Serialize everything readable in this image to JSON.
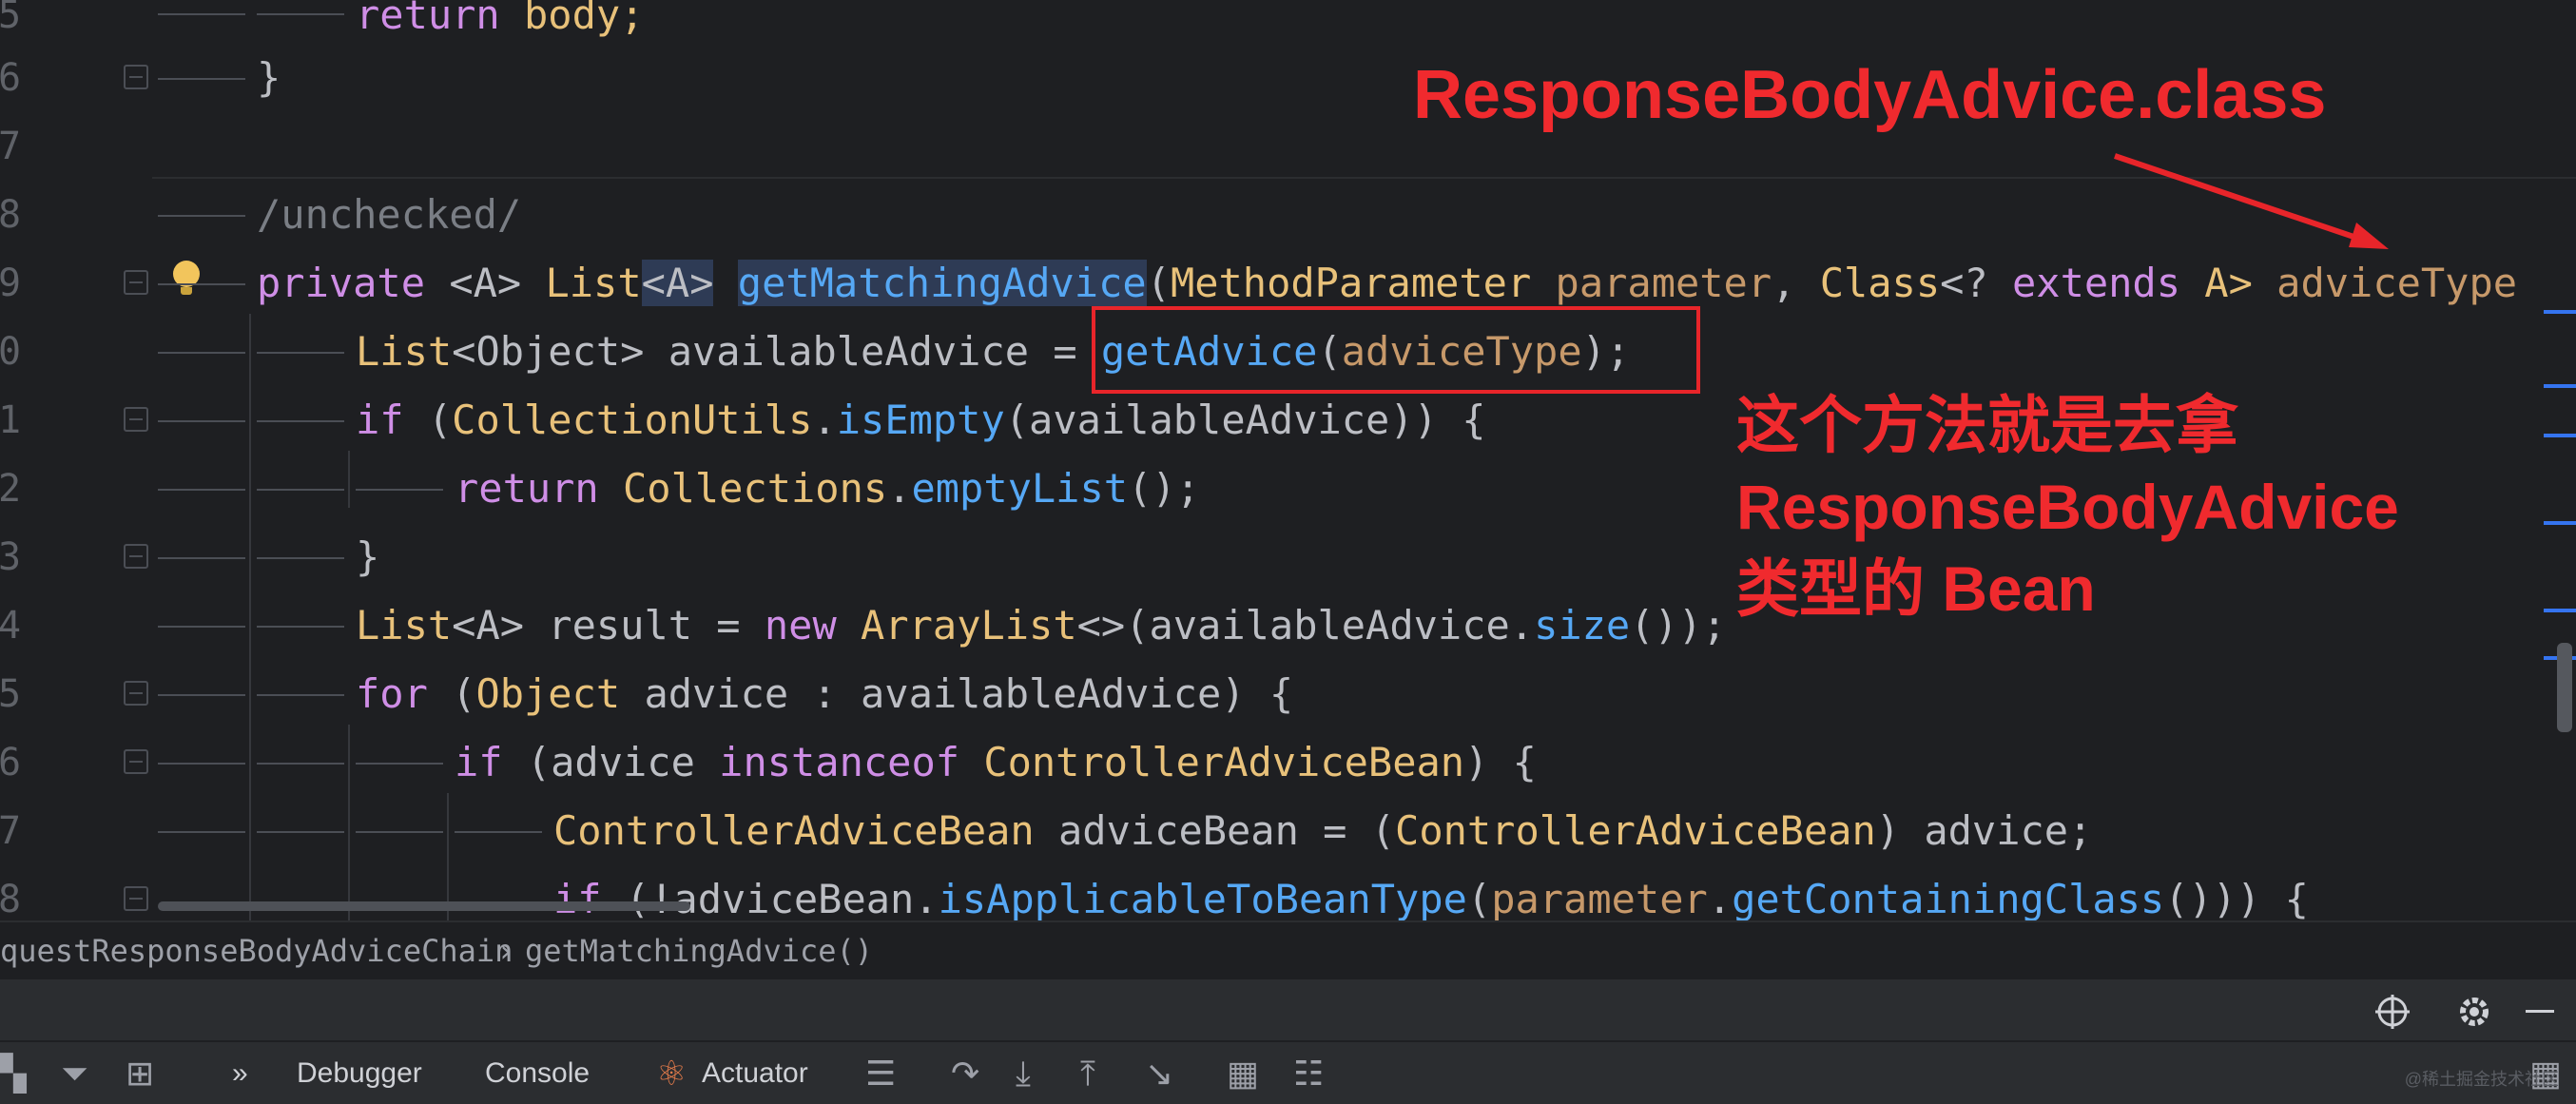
{
  "gutter": [
    "5",
    "6",
    "7",
    "8",
    "9",
    "0",
    "1",
    "2",
    "3",
    "4",
    "5",
    "6",
    "7",
    "8"
  ],
  "code": {
    "l1_kw": "return",
    "l1_rest": " body;",
    "l2": "}",
    "l4": "/unchecked/",
    "l5": {
      "private": "private",
      "generic": "<A>",
      "list": "List",
      "listA": "<A>",
      "method": "getMatchingAdvice",
      "p1type": "MethodParameter",
      "p1": "parameter",
      "comma": ", ",
      "p2type": "Class",
      "wild": "<? ",
      "extends": "extends",
      "a": " A> ",
      "p2": "adviceType"
    },
    "l6": {
      "type": "List",
      "gen": "<Object>",
      "var": " availableAdvice = ",
      "call": "getAdvice",
      "open": "(",
      "arg": "adviceType",
      "close": ");"
    },
    "l7": {
      "kw": "if",
      "open": " (",
      "cls": "CollectionUtils",
      "dot": ".",
      "call": "isEmpty",
      "rest": "(availableAdvice)) {"
    },
    "l8": {
      "kw": "return",
      "sp": " ",
      "cls": "Collections",
      "dot": ".",
      "call": "emptyList",
      "rest": "();"
    },
    "l9": "}",
    "l10": {
      "type": "List",
      "gen": "<A>",
      "var": " result = ",
      "kw": "new",
      "sp": " ",
      "cls": "ArrayList",
      "rest1": "<>(availableAdvice.",
      "call": "size",
      "rest2": "());"
    },
    "l11": {
      "kw": "for",
      "open": " (",
      "type": "Object",
      "rest": " advice : availableAdvice) {"
    },
    "l12": {
      "kw": "if",
      "rest1": " (advice ",
      "inst": "instanceof",
      "sp": " ",
      "cls": "ControllerAdviceBean",
      "rest2": ") {"
    },
    "l13": {
      "cls": "ControllerAdviceBean",
      "rest1": " adviceBean = (",
      "cls2": "ControllerAdviceBean",
      "rest2": ") advice;"
    },
    "l14": {
      "kw": "if",
      "rest1": " (!adviceBean.",
      "call": "isApplicableToBeanType",
      "open": "(",
      "pa": "parameter",
      "dot": ".",
      "call2": "getContainingClass",
      "rest2": "())) {"
    }
  },
  "annotations": {
    "top": "ResponseBodyAdvice.class",
    "side_line1": "这个方法就是去拿",
    "side_line2": "ResponseBodyAdvice",
    "side_line3": "类型的 Bean"
  },
  "breadcrumb": {
    "item1": "questResponseBodyAdviceChain",
    "sep": "›",
    "item2": "getMatchingAdvice()"
  },
  "toolbar": {
    "tab_debugger": "Debugger",
    "tab_console": "Console",
    "tab_actuator": "Actuator",
    "more": "»"
  },
  "watermark": "@稀土掘金技术社区",
  "colors": {
    "annotation": "#f02a2e",
    "keyword": "#cf8ee6",
    "type": "#e8c17a",
    "function": "#56a8f5",
    "param": "#c7996a"
  }
}
